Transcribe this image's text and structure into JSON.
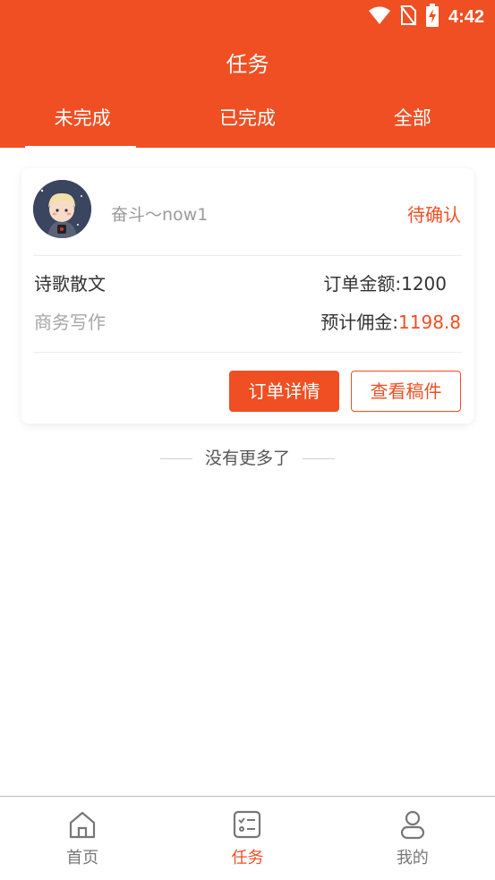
{
  "status_bar": {
    "time": "4:42"
  },
  "header": {
    "title": "任务"
  },
  "tabs": [
    {
      "label": "未完成",
      "active": true
    },
    {
      "label": "已完成",
      "active": false
    },
    {
      "label": "全部",
      "active": false
    }
  ],
  "order": {
    "username": "奋斗～now1",
    "status": "待确认",
    "category": "诗歌散文",
    "subcategory": "商务写作",
    "amount_label": "订单金额:",
    "amount_value": "1200",
    "commission_label": "预计佣金:",
    "commission_value": "1198.8",
    "detail_button": "订单详情",
    "draft_button": "查看稿件"
  },
  "list_end_text": "没有更多了",
  "bottom_nav": [
    {
      "label": "首页",
      "icon": "home-icon",
      "active": false
    },
    {
      "label": "任务",
      "icon": "task-list-icon",
      "active": true
    },
    {
      "label": "我的",
      "icon": "user-icon",
      "active": false
    }
  ],
  "colors": {
    "accent": "#f04f23",
    "text": "#333333",
    "muted": "#a6a6a6"
  }
}
